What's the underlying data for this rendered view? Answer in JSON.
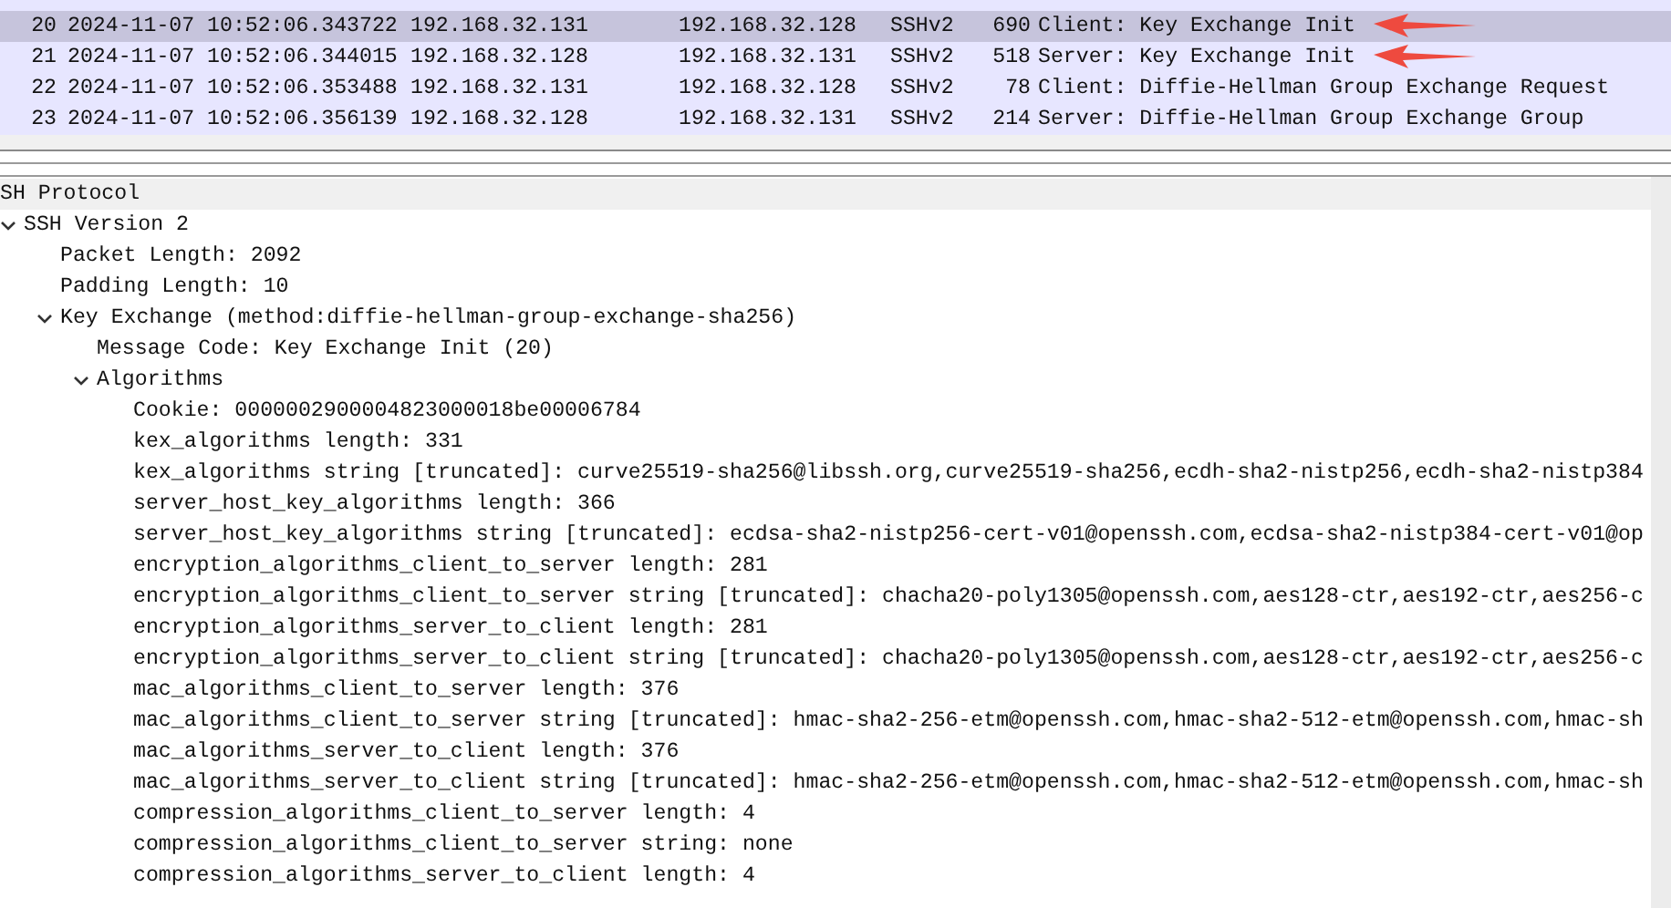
{
  "packets": [
    {
      "no": "20",
      "time": "2024-11-07 10:52:06.343722",
      "source": "192.168.32.131",
      "destination": "192.168.32.128",
      "protocol": "SSHv2",
      "length": "690",
      "info": "Client: Key Exchange Init",
      "selected": true,
      "marked": true
    },
    {
      "no": "21",
      "time": "2024-11-07 10:52:06.344015",
      "source": "192.168.32.128",
      "destination": "192.168.32.131",
      "protocol": "SSHv2",
      "length": "518",
      "info": "Server: Key Exchange Init",
      "selected": false,
      "marked": true
    },
    {
      "no": "22",
      "time": "2024-11-07 10:52:06.353488",
      "source": "192.168.32.131",
      "destination": "192.168.32.128",
      "protocol": "SSHv2",
      "length": "78",
      "info": "Client: Diffie-Hellman Group Exchange Request",
      "selected": false,
      "marked": false
    },
    {
      "no": "23",
      "time": "2024-11-07 10:52:06.356139",
      "source": "192.168.32.128",
      "destination": "192.168.32.131",
      "protocol": "SSHv2",
      "length": "214",
      "info": "Server: Diffie-Hellman Group Exchange Group",
      "selected": false,
      "marked": false
    }
  ],
  "details": [
    {
      "label": "SH Protocol",
      "kind": "header",
      "children": [
        {
          "label": "SSH Version 2",
          "kind": "node",
          "expanded": true,
          "children": [
            {
              "label": "Packet Length: 2092",
              "kind": "leaf"
            },
            {
              "label": "Padding Length: 10",
              "kind": "leaf"
            },
            {
              "label": "Key Exchange (method:diffie-hellman-group-exchange-sha256)",
              "kind": "node",
              "expanded": true,
              "children": [
                {
                  "label": "Message Code: Key Exchange Init (20)",
                  "kind": "leaf"
                },
                {
                  "label": "Algorithms",
                  "kind": "node",
                  "expanded": true,
                  "children": [
                    {
                      "label": "Cookie: 0000002900004823000018be00006784",
                      "kind": "leaf"
                    },
                    {
                      "label": "kex_algorithms length: 331",
                      "kind": "leaf"
                    },
                    {
                      "label": "kex_algorithms string [truncated]: curve25519-sha256@libssh.org,curve25519-sha256,ecdh-sha2-nistp256,ecdh-sha2-nistp384",
                      "kind": "leaf"
                    },
                    {
                      "label": "server_host_key_algorithms length: 366",
                      "kind": "leaf"
                    },
                    {
                      "label": "server_host_key_algorithms string [truncated]: ecdsa-sha2-nistp256-cert-v01@openssh.com,ecdsa-sha2-nistp384-cert-v01@op",
                      "kind": "leaf"
                    },
                    {
                      "label": "encryption_algorithms_client_to_server length: 281",
                      "kind": "leaf"
                    },
                    {
                      "label": "encryption_algorithms_client_to_server string [truncated]: chacha20-poly1305@openssh.com,aes128-ctr,aes192-ctr,aes256-c",
                      "kind": "leaf"
                    },
                    {
                      "label": "encryption_algorithms_server_to_client length: 281",
                      "kind": "leaf"
                    },
                    {
                      "label": "encryption_algorithms_server_to_client string [truncated]: chacha20-poly1305@openssh.com,aes128-ctr,aes192-ctr,aes256-c",
                      "kind": "leaf"
                    },
                    {
                      "label": "mac_algorithms_client_to_server length: 376",
                      "kind": "leaf"
                    },
                    {
                      "label": "mac_algorithms_client_to_server string [truncated]: hmac-sha2-256-etm@openssh.com,hmac-sha2-512-etm@openssh.com,hmac-sh",
                      "kind": "leaf"
                    },
                    {
                      "label": "mac_algorithms_server_to_client length: 376",
                      "kind": "leaf"
                    },
                    {
                      "label": "mac_algorithms_server_to_client string [truncated]: hmac-sha2-256-etm@openssh.com,hmac-sha2-512-etm@openssh.com,hmac-sh",
                      "kind": "leaf"
                    },
                    {
                      "label": "compression_algorithms_client_to_server length: 4",
                      "kind": "leaf"
                    },
                    {
                      "label": "compression_algorithms_client_to_server string: none",
                      "kind": "leaf"
                    },
                    {
                      "label": "compression_algorithms_server_to_client length: 4",
                      "kind": "leaf"
                    }
                  ]
                }
              ]
            }
          ]
        }
      ]
    }
  ]
}
